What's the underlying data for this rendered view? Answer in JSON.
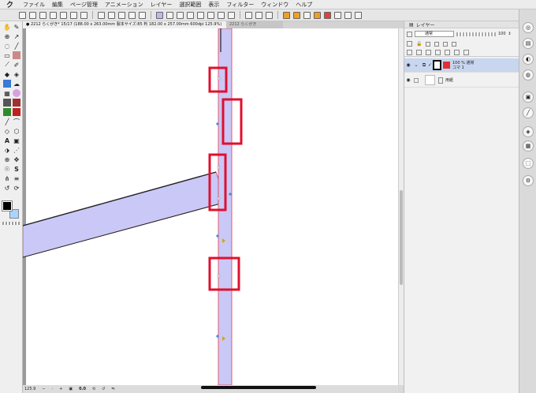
{
  "menu": {
    "logo": "ク",
    "items": [
      "ファイル",
      "編集",
      "ページ管理",
      "アニメーション",
      "レイヤー",
      "選択範囲",
      "表示",
      "フィルター",
      "ウィンドウ",
      "ヘルプ"
    ]
  },
  "tabs": {
    "active": "● 2212 らくがき* 15/17 (188.00 x 263.00mm 製本サイズ:85 判 182.00 x 257.00mm 600dpi 125.9%)",
    "inactive": "2212 らくがき"
  },
  "layer_panel": {
    "title": "レイヤー",
    "blend_mode": "通常",
    "opacity_value": "100",
    "layers": [
      {
        "line1": "100 % 通常",
        "line2": "コマ 1",
        "selected": true
      },
      {
        "line1": "",
        "line2": "用紙",
        "selected": false
      }
    ]
  },
  "status": {
    "zoom": "125.9",
    "angle": "0.0"
  },
  "colors": {
    "panel_fill": "#c9c8f7",
    "panel_border": "#e33a4a",
    "highlight_box": "#e0102e",
    "selection_blue": "#c8d6ef",
    "main_color": "#000000",
    "sub_color": "#a9d4ff"
  },
  "icons": {
    "toolbar": [
      "new-file-icon",
      "open-icon",
      "save-icon",
      "undo-icon",
      "redo-icon",
      "transform-icon",
      "ruler-icon",
      "snap-icon",
      "layer-icon",
      "pen-icon"
    ],
    "tools": [
      "pen-tool-icon",
      "magnifier-icon",
      "move-icon",
      "selection-icon",
      "lasso-icon",
      "eyedropper-icon",
      "brush-icon",
      "eraser-icon",
      "fill-icon",
      "gradient-icon",
      "text-icon",
      "figure-icon",
      "frame-icon",
      "operation-icon"
    ]
  }
}
